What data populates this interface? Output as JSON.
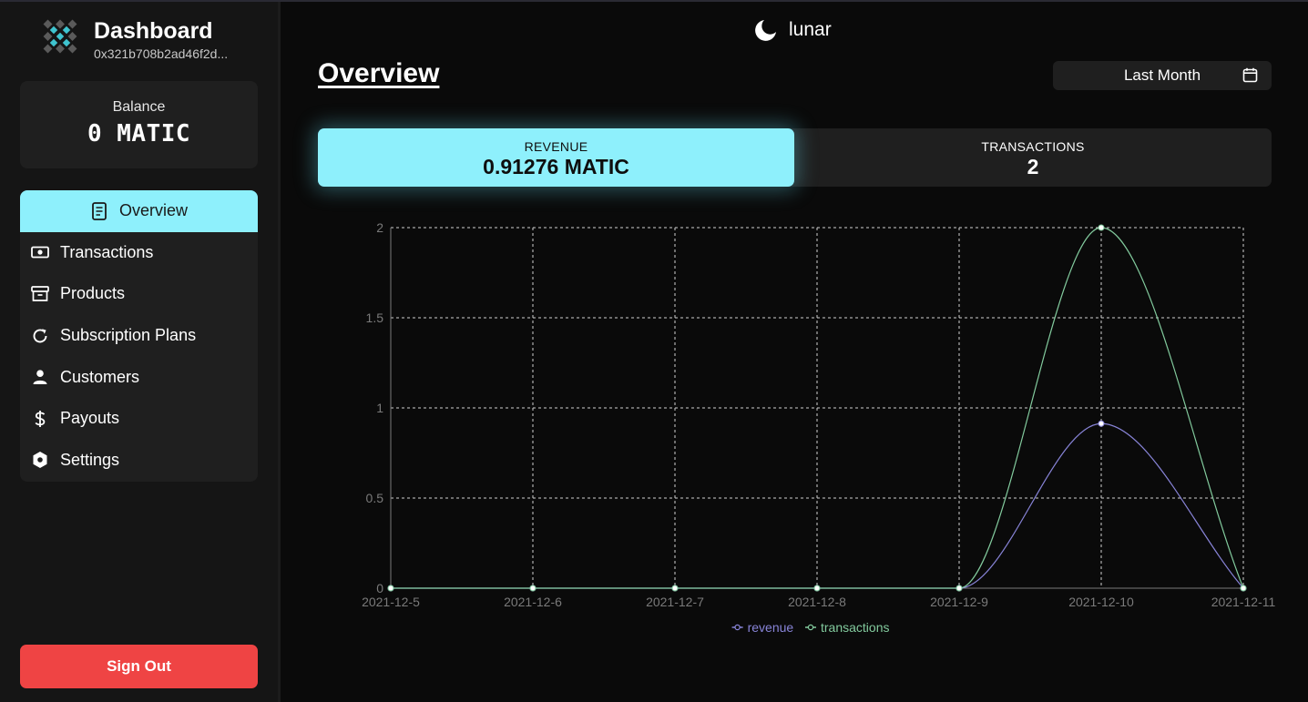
{
  "sidebar": {
    "brand_title": "Dashboard",
    "wallet_address": "0x321b708b2ad46f2d...",
    "balance_label": "Balance",
    "balance_value": "0 MATIC",
    "nav": [
      {
        "label": "Overview",
        "icon": "document-icon",
        "active": true
      },
      {
        "label": "Transactions",
        "icon": "cash-icon",
        "active": false
      },
      {
        "label": "Products",
        "icon": "archive-box-icon",
        "active": false
      },
      {
        "label": "Subscription Plans",
        "icon": "refresh-icon",
        "active": false
      },
      {
        "label": "Customers",
        "icon": "user-icon",
        "active": false
      },
      {
        "label": "Payouts",
        "icon": "dollar-icon",
        "active": false
      },
      {
        "label": "Settings",
        "icon": "hexagon-settings-icon",
        "active": false
      }
    ],
    "sign_out_label": "Sign Out"
  },
  "header": {
    "brand": "lunar",
    "brand_icon": "moon-icon",
    "page_title": "Overview",
    "date_range": "Last Month",
    "date_icon": "calendar-icon"
  },
  "stats": {
    "revenue_label": "REVENUE",
    "revenue_value": "0.91276 MATIC",
    "transactions_label": "TRANSACTIONS",
    "transactions_value": "2"
  },
  "colors": {
    "accent": "#8ef0fc",
    "danger": "#ef4444",
    "revenue_series": "#8884d8",
    "transactions_series": "#82ca9d",
    "card": "#1f1f1f",
    "background": "#0a0a0a"
  },
  "chart_data": {
    "type": "line",
    "x": [
      "2021-12-5",
      "2021-12-6",
      "2021-12-7",
      "2021-12-8",
      "2021-12-9",
      "2021-12-10",
      "2021-12-11"
    ],
    "series": [
      {
        "name": "revenue",
        "values": [
          0,
          0,
          0,
          0,
          0,
          0.91276,
          0
        ],
        "color": "#8884d8"
      },
      {
        "name": "transactions",
        "values": [
          0,
          0,
          0,
          0,
          0,
          2,
          0
        ],
        "color": "#82ca9d"
      }
    ],
    "y_ticks": [
      "0",
      "0.5",
      "1",
      "1.5",
      "2"
    ],
    "ylim": [
      0,
      2
    ],
    "grid": true,
    "legend": "bottom",
    "smooth": true
  }
}
